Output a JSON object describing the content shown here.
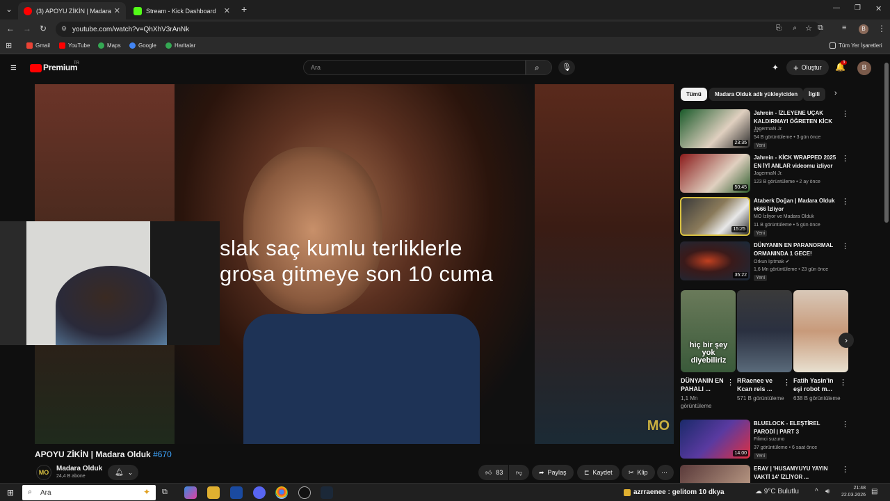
{
  "browser": {
    "tabs": [
      {
        "title": "(3) APOYU ZİKİN | Madara Oldu",
        "active": true
      },
      {
        "title": "Stream - Kick Dashboard",
        "active": false
      }
    ],
    "url": "youtube.com/watch?v=QhXhV3rAnNk",
    "bookmarks": [
      "Gmail",
      "YouTube",
      "Maps",
      "Google",
      "Haritalar"
    ],
    "all_bookmarks": "Tüm Yer İşaretleri",
    "profile_initial": "B"
  },
  "youtube": {
    "logo": "Premium",
    "region": "TR",
    "search_placeholder": "Ara",
    "create_label": "Oluştur",
    "notif_count": "3",
    "avatar": "B"
  },
  "video": {
    "subtitle_line1": "slak saç kumlu terliklerle",
    "subtitle_line2": "grosa gitmeye son 10 cuma",
    "title": "APOYU ZİKİN | Madara Olduk",
    "hashtag": "#670",
    "channel_name": "Madara Olduk",
    "subscribers": "24,4 B abone",
    "channel_logo": "MO",
    "likes": "83",
    "share_label": "Paylaş",
    "save_label": "Kaydet",
    "clip_label": "Klip",
    "corner_logo": "MO"
  },
  "chips": [
    "Tümü",
    "Madara Olduk adlı yükleyiciden",
    "İlgili"
  ],
  "recommendations": [
    {
      "title": "Jahrein - İZLEYENE UÇAK KALDIRMAYI ÖĞRETEN KİCK ...",
      "channel": "JagermaN Jr.",
      "meta": "54 B görüntüleme • 3 gün önce",
      "badge": "Yeni",
      "duration": "23:35",
      "thumb_color": "#3a6a3a"
    },
    {
      "title": "Jahrein - KİCK WRAPPED 2025 EN İYİ ANLAR videomu izliyor",
      "channel": "JagermaN Jr.",
      "meta": "123 B görüntüleme • 2 ay önce",
      "badge": "",
      "duration": "50:45",
      "thumb_color": "#6a2a2a"
    },
    {
      "title": "Ataberk Doğan | Madara Olduk #666 İzliyor",
      "channel": "MO İzliyor ve Madara Olduk",
      "meta": "11 B görüntüleme • 5 gün önce",
      "badge": "Yeni",
      "duration": "15:25",
      "thumb_color": "#5a5a2a"
    },
    {
      "title": "DÜNYANIN EN PARANORMAL ORMANINDA 1 GECE!",
      "channel": "Orkun Işıtmak",
      "meta": "1,6 Mn görüntüleme • 23 gün önce",
      "badge": "Yeni",
      "duration": "35:22",
      "thumb_color": "#2a2a3a"
    }
  ],
  "shorts": [
    {
      "title": "DÜNYANIN EN PAHALI ...",
      "views": "1,1 Mn görüntüleme",
      "overlay": "hiç bir şey yok diyebiliriz",
      "color": "#2a4a2a"
    },
    {
      "title": "RRaenee ve Kcan reis ...",
      "views": "571 B görüntüleme",
      "overlay": "",
      "color": "#2a3040"
    },
    {
      "title": "Fatih Yasin'in eşi robot m...",
      "views": "638 B görüntüleme",
      "overlay": "",
      "color": "#c8b8a8"
    }
  ],
  "recommendations2": [
    {
      "title": "BLUELOCK - ELEŞTİREL PARODİ | PART 3",
      "channel": "Filimci suzuno",
      "meta": "37 görüntüleme • 6 saat önce",
      "badge": "Yeni",
      "duration": "14:00",
      "thumb_color": "#2a3a7a"
    },
    {
      "title": "ERAY | 'HUSAMYUYU YAYIN VAKTİ 14' İZLİYOR ...",
      "channel": "",
      "meta": "",
      "badge": "",
      "duration": "",
      "thumb_color": "#5a3a3a"
    }
  ],
  "taskbar": {
    "search": "Ara",
    "ticker": "azrraenee : gelitom 10 dkya",
    "weather": "9°C Bulutlu",
    "time": "21:48",
    "date": "22.03.2026"
  }
}
